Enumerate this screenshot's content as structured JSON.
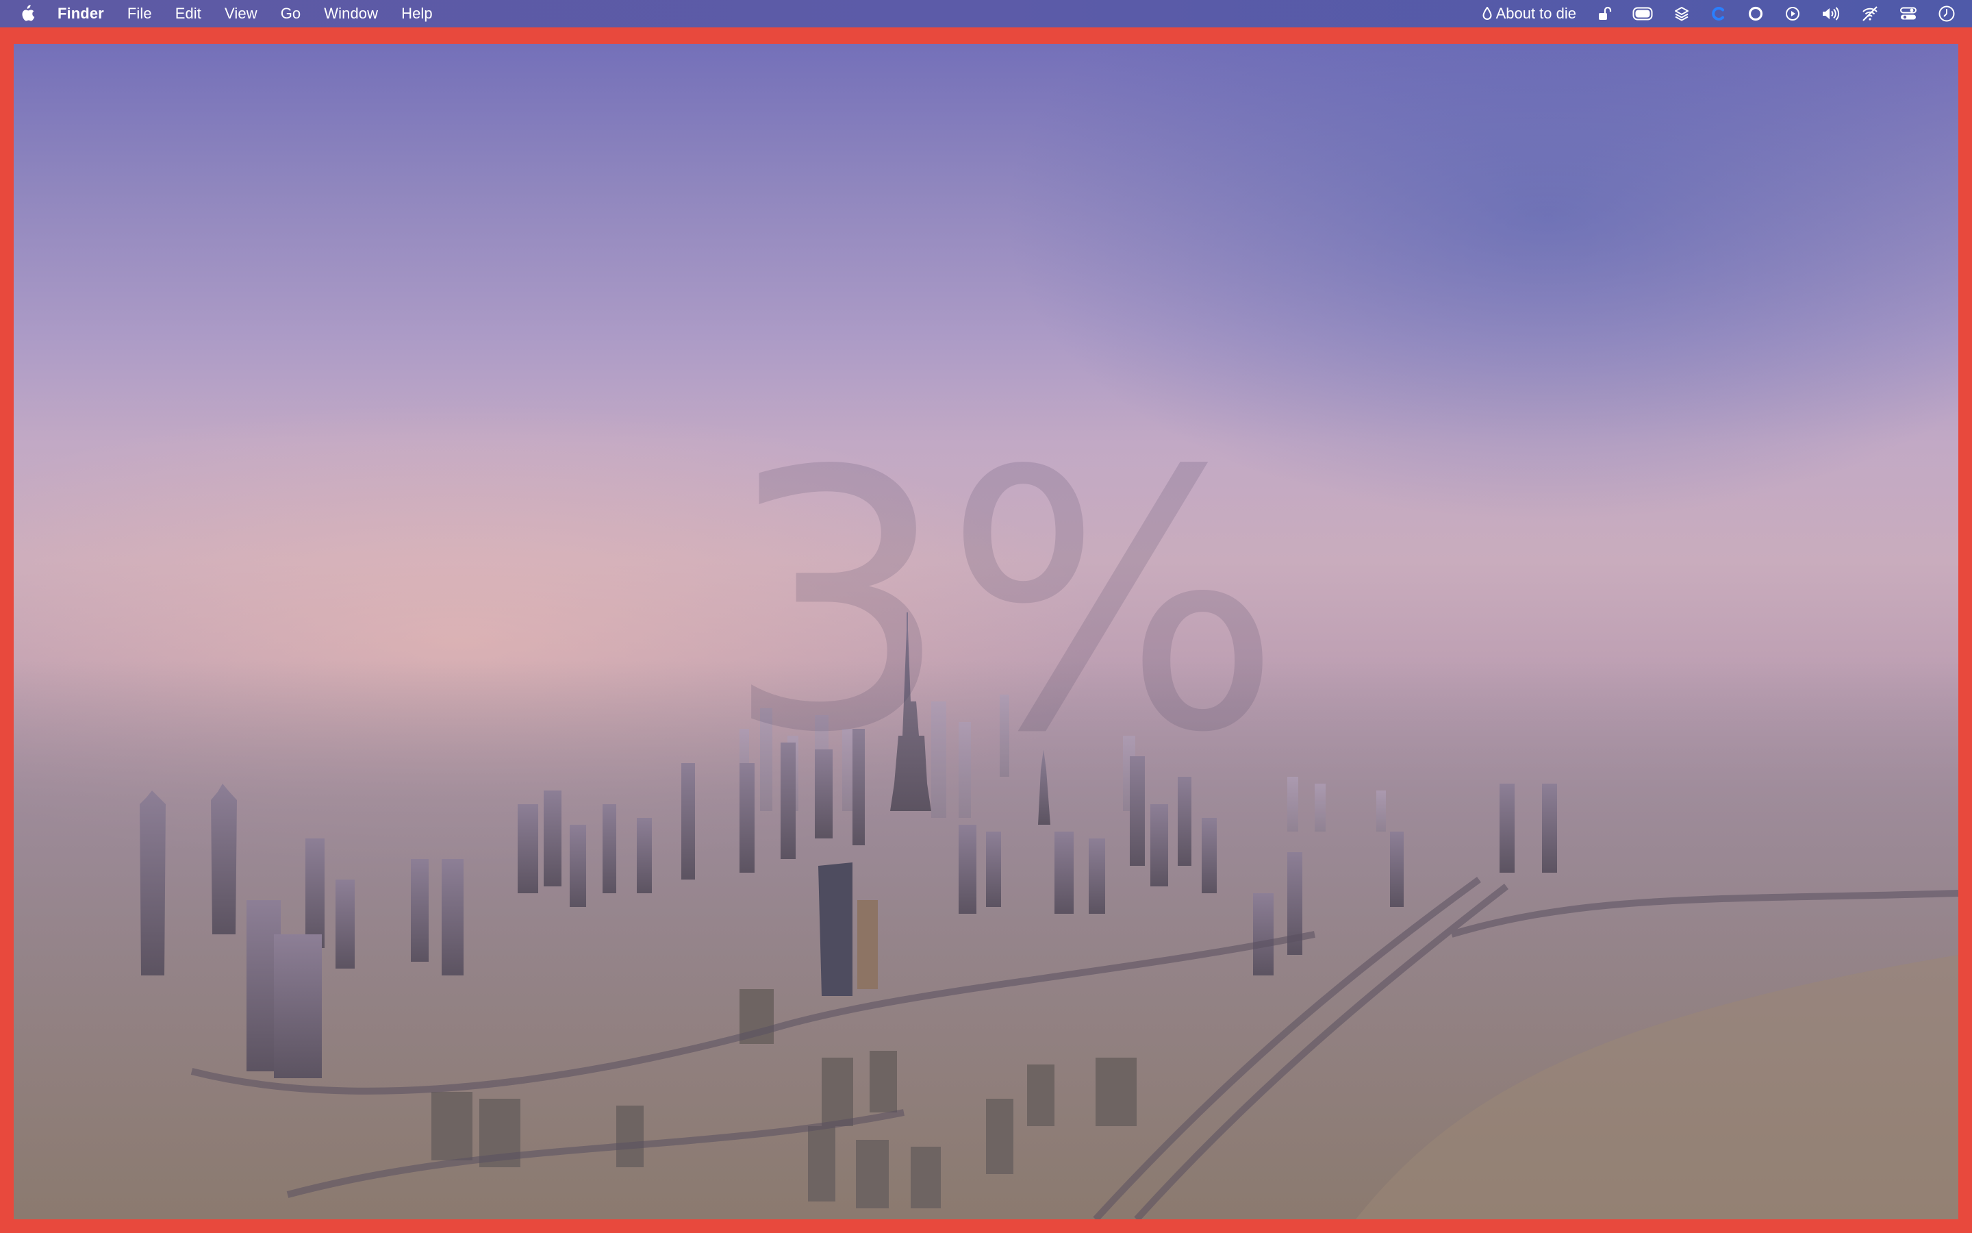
{
  "menubar": {
    "apple_icon": "apple-logo-icon",
    "items": [
      {
        "label": "Finder",
        "bold": true
      },
      {
        "label": "File"
      },
      {
        "label": "Edit"
      },
      {
        "label": "View"
      },
      {
        "label": "Go"
      },
      {
        "label": "Window"
      },
      {
        "label": "Help"
      }
    ],
    "status": {
      "battery_alert_icon": "drop-icon",
      "battery_alert_text": "About to die",
      "icons": [
        "unlock-icon",
        "toggle-pill-icon",
        "layers-icon",
        "c-logo-icon",
        "circle-icon",
        "play-circle-icon",
        "volume-icon",
        "wifi-off-icon",
        "control-center-icon",
        "clock-icon"
      ]
    }
  },
  "desktop": {
    "battery_percent": "3%",
    "frame_color": "#e8493d",
    "wallpaper": "hazy-city-skyline"
  }
}
